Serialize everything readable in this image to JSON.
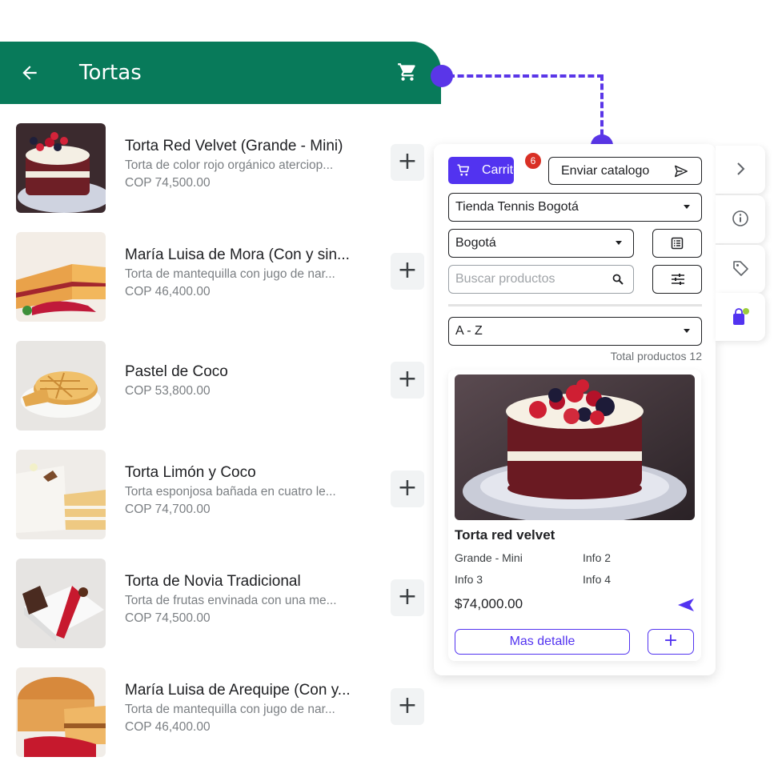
{
  "app": {
    "title": "Tortas",
    "back_icon": "arrow-left-icon",
    "cart_icon": "shopping-cart-icon",
    "bar_color": "#087a5a"
  },
  "products": [
    {
      "name": "Torta Red Velvet  (Grande - Mini)",
      "description": "Torta de color rojo orgánico aterciop...",
      "price": "COP 74,500.00",
      "add": "+"
    },
    {
      "name": "María Luisa de Mora (Con y sin...",
      "description": "Torta de mantequilla con jugo de nar...",
      "price": "COP 46,400.00",
      "add": "+"
    },
    {
      "name": "Pastel de Coco",
      "description": "",
      "price": "COP 53,800.00",
      "add": "+"
    },
    {
      "name": "Torta Limón y Coco",
      "description": "Torta esponjosa bañada en cuatro le...",
      "price": "COP 74,700.00",
      "add": "+"
    },
    {
      "name": "Torta de Novia Tradicional",
      "description": "Torta de frutas envinada con una me...",
      "price": "COP 74,500.00",
      "add": "+"
    },
    {
      "name": "María Luisa de Arequipe (Con y...",
      "description": "Torta de mantequilla con jugo de nar...",
      "price": "COP 46,400.00",
      "add": "+"
    }
  ],
  "widget": {
    "accent_color": "#5233f0",
    "cart_button": "Carrito",
    "cart_badge": "6",
    "send_catalog_button": "Enviar catalogo",
    "store_select": "Tienda Tennis Bogotá",
    "city_select": "Bogotá",
    "search_placeholder": "Buscar productos",
    "sort_select": "A - Z",
    "total_products": "Total productos 12",
    "card": {
      "title": "Torta red velvet",
      "info1": "Grande - Mini",
      "info2": "Info 2",
      "info3": "Info 3",
      "info4": "Info 4",
      "price": "$74,000.00",
      "detail_button": "Mas detalle",
      "add_button": "+"
    }
  },
  "side_tabs": [
    "chevron-right-icon",
    "info-icon",
    "tag-icon",
    "shopping-bag-icon"
  ]
}
